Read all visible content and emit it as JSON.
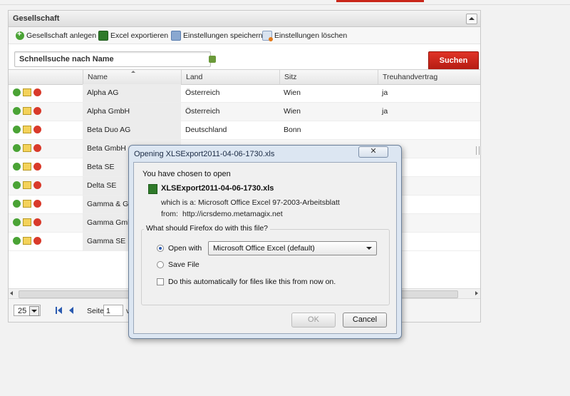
{
  "panel": {
    "title": "Gesellschaft",
    "toolbar": {
      "add_label": "Gesellschaft anlegen",
      "export_label": "Excel exportieren",
      "save_label": "Einstellungen speichern",
      "delete_label": "Einstellungen löschen"
    },
    "search": {
      "placeholder": "Schnellsuche nach Name",
      "button_label": "Suchen"
    },
    "columns": [
      "Name",
      "Land",
      "Sitz",
      "Treuhandvertrag"
    ],
    "rows": [
      {
        "name": "Alpha AG",
        "land": "Österreich",
        "sitz": "Wien",
        "treuhand": "ja"
      },
      {
        "name": "Alpha GmbH",
        "land": "Österreich",
        "sitz": "Wien",
        "treuhand": "ja"
      },
      {
        "name": "Beta Duo AG",
        "land": "Deutschland",
        "sitz": "Bonn",
        "treuhand": ""
      },
      {
        "name": "Beta GmbH",
        "land": "",
        "sitz": "",
        "treuhand": ""
      },
      {
        "name": "Beta SE",
        "land": "",
        "sitz": "",
        "treuhand": ""
      },
      {
        "name": "Delta SE",
        "land": "",
        "sitz": "",
        "treuhand": ""
      },
      {
        "name": "Gamma & Gam",
        "land": "",
        "sitz": "",
        "treuhand": ""
      },
      {
        "name": "Gamma Gmbh",
        "land": "",
        "sitz": "",
        "treuhand": ""
      },
      {
        "name": "Gamma SE",
        "land": "",
        "sitz": "",
        "treuhand": ""
      }
    ],
    "pager": {
      "page_size": "25",
      "page_label": "Seite",
      "page_value": "1",
      "of_label": "v"
    }
  },
  "dialog": {
    "title": "Opening XLSExport2011-04-06-1730.xls",
    "close_label": "✕",
    "chosen_text": "You have chosen to open",
    "file_name": "XLSExport2011-04-06-1730.xls",
    "which_label": "which is a:",
    "which_value": "Microsoft Office Excel 97-2003-Arbeitsblatt",
    "from_label": "from:",
    "from_value": "http://icrsdemo.metamagix.net",
    "question": "What should Firefox do with this file?",
    "open_with_label": "Open with",
    "open_with_app": "Microsoft Office Excel (default)",
    "save_file_label": "Save File",
    "auto_label": "Do this automatically for files like this from now on.",
    "ok_label": "OK",
    "cancel_label": "Cancel"
  },
  "colors": {
    "accent_red": "#c9261a",
    "search_button": "#d0281c"
  }
}
